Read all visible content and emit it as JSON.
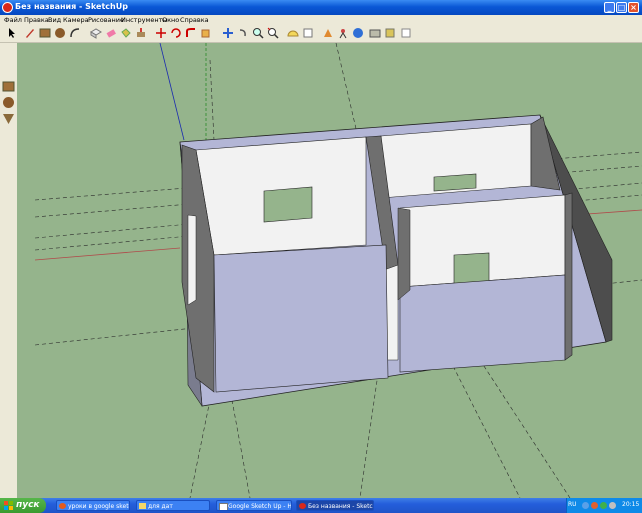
{
  "window": {
    "title": "Без названия - SketchUp",
    "controls": {
      "minimize": "_",
      "maximize": "□",
      "close": "×"
    }
  },
  "menu": [
    "Файл",
    "Правка",
    "Вид",
    "Камера",
    "Рисование",
    "Инструменты",
    "Окно",
    "Справка"
  ],
  "toolbar_icons": [
    "select-icon",
    "pencil-icon",
    "rectangle-icon",
    "circle-icon",
    "arc-icon",
    "make-component-icon",
    "eraser-icon",
    "paint-bucket-icon",
    "push-pull-icon",
    "move-icon",
    "rotate-icon",
    "follow-me-icon",
    "scale-icon",
    "offset-icon",
    "tape-measure-icon",
    "dimension-icon",
    "protractor-icon",
    "text-icon",
    "orbit-icon",
    "pan-icon",
    "zoom-icon",
    "zoom-extents-icon",
    "section-plane-icon",
    "position-camera-icon",
    "walk-icon",
    "look-around-icon",
    "get-models-icon",
    "share-model-icon",
    "components-icon"
  ],
  "sidebar_icons": [
    "rectangle-icon",
    "pencil-icon",
    "circle-icon",
    "arc-icon",
    "push-pull-icon",
    "follow-me-icon"
  ],
  "colors": {
    "titlebar": "#0a58d6",
    "viewport_background": "#95b48c",
    "floor": "#b3b6d6",
    "wall_light": "#f2f2f2",
    "wall_dark": "#6f6f6f"
  },
  "taskbar": {
    "start_label": "пуск",
    "tasks": [
      {
        "label": "уроки в google sketc...",
        "icon": "firefox-icon",
        "active": false
      },
      {
        "label": "для дат",
        "icon": "folder-icon",
        "active": false
      },
      {
        "label": "Google Sketch Up - Hi...",
        "icon": "document-icon",
        "active": false
      },
      {
        "label": "Без названия - Sketc...",
        "icon": "sketchup-icon",
        "active": true
      }
    ],
    "language": "RU",
    "clock": "20:15"
  }
}
